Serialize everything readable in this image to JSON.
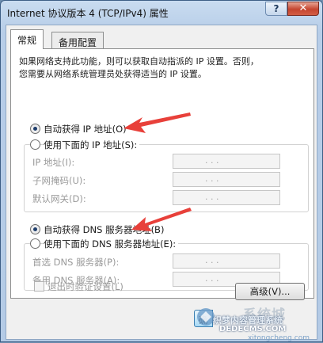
{
  "window": {
    "title": "Internet 协议版本 4 (TCP/IPv4) 属性",
    "help_label": "?",
    "close_label": "✕"
  },
  "tabs": [
    {
      "label": "常规",
      "active": true
    },
    {
      "label": "备用配置",
      "active": false
    }
  ],
  "general": {
    "description_line1": "如果网络支持此功能，则可以获取自动指派的 IP 设置。否则，",
    "description_line2": "您需要从网络系统管理员处获得适当的 IP 设置。",
    "ip_auto_label": "自动获得 IP 地址(O)",
    "ip_manual_label": "使用下面的 IP 地址(S):",
    "ip_address_label": "IP 地址(I):",
    "subnet_label": "子网掩码(U):",
    "gateway_label": "默认网关(D):",
    "dns_auto_label": "自动获得 DNS 服务器地址(B)",
    "dns_manual_label": "使用下面的 DNS 服务器地址(E):",
    "dns_preferred_label": "首选 DNS 服务器(P):",
    "dns_alternate_label": "备用 DNS 服务器(A):",
    "ip_dots": ".   .   .",
    "validate_label": "退出时验证设置(L)",
    "advanced_label": "高级(V)..."
  },
  "state": {
    "ip_mode": "auto",
    "dns_mode": "auto",
    "validate_on_exit": false
  },
  "footer": {
    "ok_partial": "确"
  },
  "watermark": {
    "brand": "系统城",
    "line1": "织梦内容管理系统",
    "line2": "DEDECMS.COM",
    "line3": "xitongcheng.com"
  },
  "colors": {
    "arrow": "#e8403a",
    "accent": "#1f3e6c"
  }
}
